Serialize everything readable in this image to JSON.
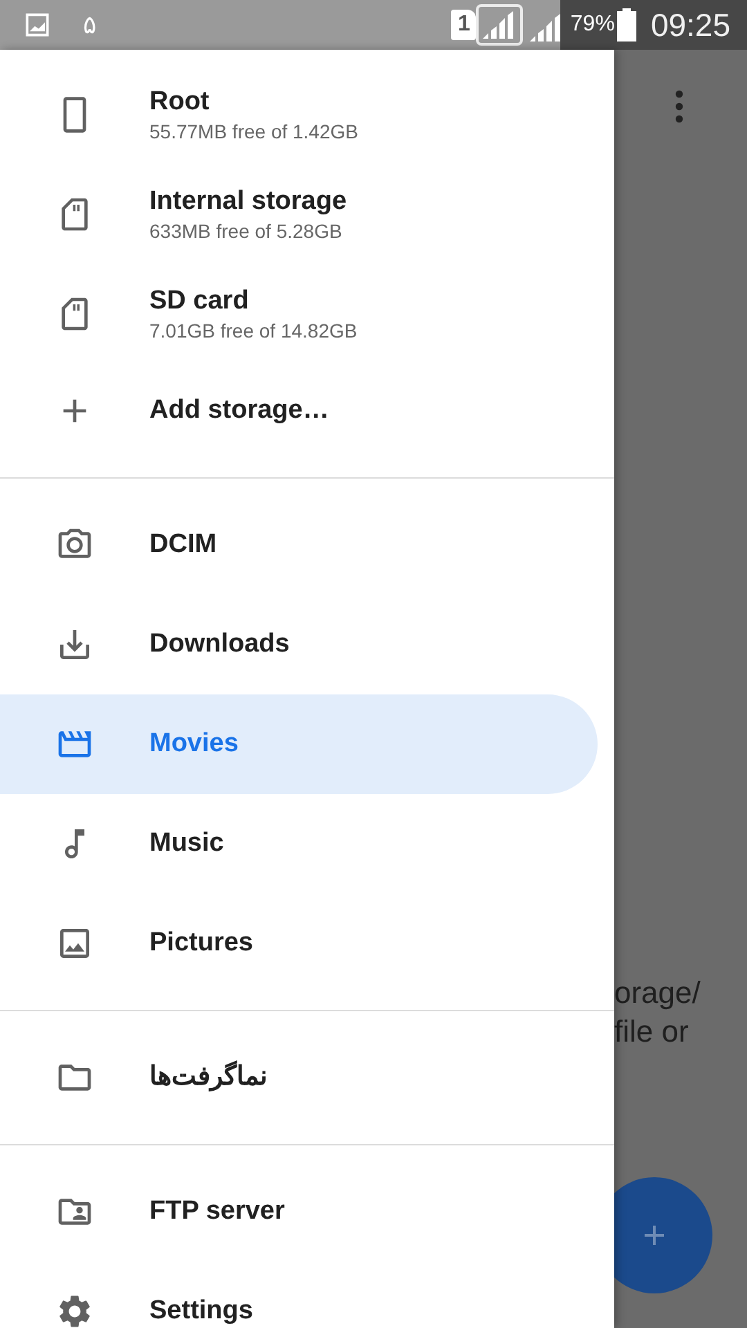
{
  "status_bar": {
    "notification": "۵",
    "sim": "1",
    "battery": "79%",
    "time": "09:25"
  },
  "background": {
    "lines": [
      "orage/",
      "file or"
    ]
  },
  "drawer": {
    "sections": [
      {
        "items": [
          {
            "label": "Root",
            "detail": "55.77MB free of 1.42GB",
            "selected": false
          },
          {
            "label": "Internal storage",
            "detail": "633MB free of 5.28GB",
            "selected": false
          },
          {
            "label": "SD card",
            "detail": "7.01GB free of 14.82GB",
            "selected": false
          },
          {
            "label": "Add storage…",
            "selected": false
          }
        ]
      },
      {
        "items": [
          {
            "label": "DCIM",
            "selected": false
          },
          {
            "label": "Downloads",
            "selected": false
          },
          {
            "label": "Movies",
            "selected": true
          },
          {
            "label": "Music",
            "selected": false
          },
          {
            "label": "Pictures",
            "selected": false
          }
        ]
      },
      {
        "items": [
          {
            "label": "نماگرفت‌ها",
            "selected": false
          }
        ]
      },
      {
        "items": [
          {
            "label": "FTP server",
            "selected": false
          },
          {
            "label": "Settings",
            "selected": false
          }
        ]
      }
    ]
  }
}
